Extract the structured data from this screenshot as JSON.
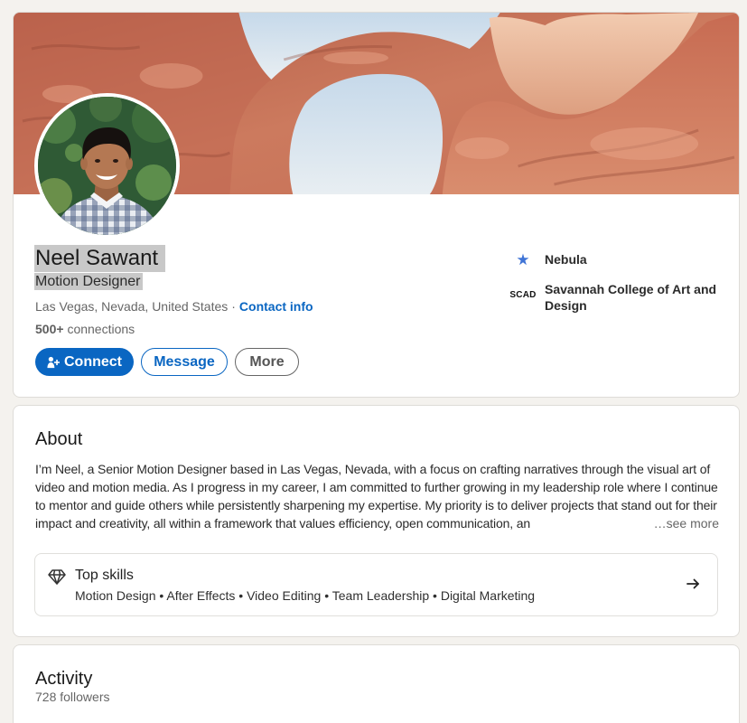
{
  "profile": {
    "name": "Neel Sawant",
    "headline": "Motion Designer",
    "location": "Las Vegas, Nevada, United States",
    "location_separator": "·",
    "contact_info": "Contact info",
    "connections_count": "500+",
    "connections_label": "connections",
    "actions": {
      "connect": "Connect",
      "message": "Message",
      "more": "More"
    },
    "organizations": [
      {
        "logo_icon": "nebula-star-icon",
        "name": "Nebula"
      },
      {
        "logo_text": "SCAD",
        "name": "Savannah College of Art and Design"
      }
    ]
  },
  "about": {
    "title": "About",
    "text": "I’m Neel, a Senior Motion Designer based in Las Vegas, Nevada, with a focus on crafting narratives through the visual art of video and motion media. As I progress in my career, I am committed to further growing in my leadership role where I continue to mentor and guide others while persistently sharpening my expertise. My priority is to deliver projects that stand out for their impact and creativity, all within a framework that values efficiency, open communication, an",
    "see_more": "…see more"
  },
  "top_skills": {
    "title": "Top skills",
    "skills": "Motion Design • After Effects • Video Editing • Team Leadership • Digital Marketing"
  },
  "activity": {
    "title": "Activity",
    "followers": "728 followers"
  },
  "icons": {
    "connect": "person-add-icon",
    "experience_logo": "nebula-star-icon",
    "top_skills": "diamond-icon",
    "top_skills_link": "arrow-right-icon"
  },
  "colors": {
    "accent": "#0a66c2",
    "page_background": "#f4f2ee",
    "card_background": "#ffffff",
    "selection_highlight": "#c8c8c8"
  }
}
